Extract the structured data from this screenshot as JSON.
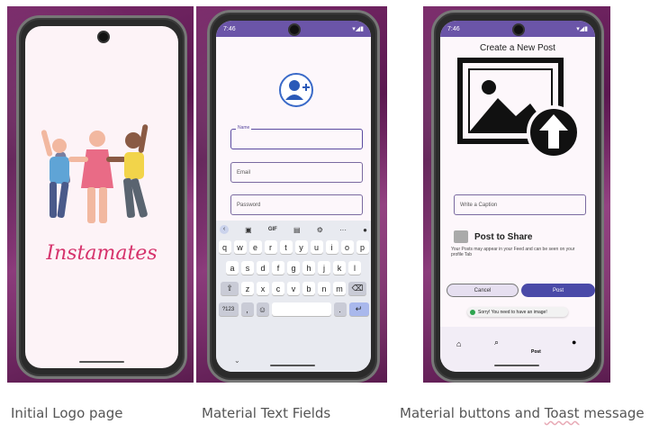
{
  "screens": [
    {
      "status_time": "",
      "app_title": "Instamates",
      "caption": "Initial Logo page"
    },
    {
      "status_time": "7:46",
      "name_label": "Name",
      "email_placeholder": "Email",
      "password_placeholder": "Password",
      "keyboard": {
        "toolbar": [
          "GIF"
        ],
        "row1": [
          "q",
          "w",
          "e",
          "r",
          "t",
          "y",
          "u",
          "i",
          "o",
          "p"
        ],
        "row1_hints": [
          "1",
          "2",
          "3",
          "4",
          "5",
          "6",
          "7",
          "8",
          "9",
          "0"
        ],
        "row2": [
          "a",
          "s",
          "d",
          "f",
          "g",
          "h",
          "j",
          "k",
          "l"
        ],
        "row3": [
          "z",
          "x",
          "c",
          "v",
          "b",
          "n",
          "m"
        ],
        "num_key": "?123",
        "comma": ",",
        "period": "."
      },
      "caption": "Material Text Fields"
    },
    {
      "status_time": "7:46",
      "header_title": "Create a New Post",
      "caption_placeholder": "Write a Caption",
      "share_title": "Post to Share",
      "share_description": "Your Posts may appear in your Feed and can be seen on your profile Tab",
      "cancel_label": "Cancel",
      "post_label": "Post",
      "toast_text": "Sorry! You need to have an image!",
      "nav_post_label": "Post",
      "caption_prefix": "Material buttons and ",
      "caption_toast": "Toast",
      "caption_suffix": " message"
    }
  ],
  "colors": {
    "accent_purple": "#6b55a8",
    "post_button": "#4a4aa8",
    "logo_pink": "#d6336c"
  }
}
